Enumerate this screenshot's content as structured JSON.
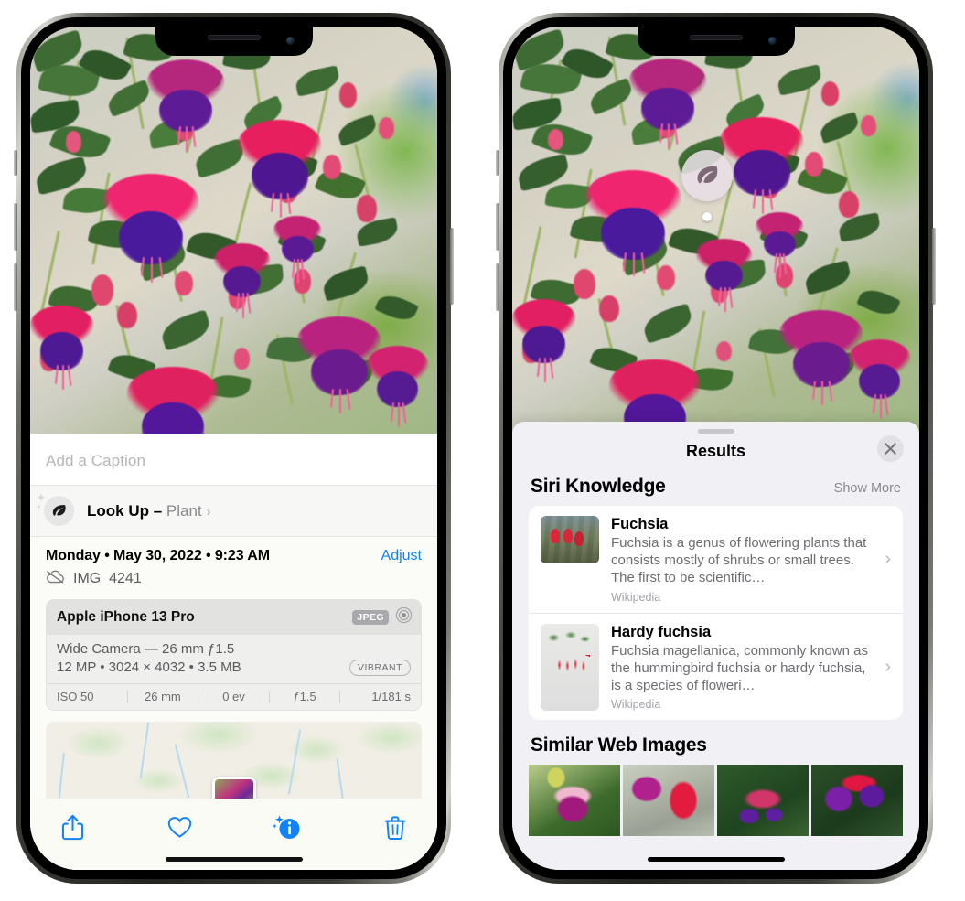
{
  "device": {
    "model_name": "iPhone",
    "buttons": [
      "silent-switch",
      "volume-up",
      "volume-down",
      "side-button"
    ]
  },
  "left_phone": {
    "screen": "photos-info-view",
    "caption": {
      "value": "",
      "placeholder": "Add a Caption"
    },
    "lookup": {
      "icon": "leaf-icon",
      "label": "Look Up",
      "dash": " – ",
      "subject": "Plant",
      "chevron": "›"
    },
    "meta": {
      "datetime": "Monday • May 30, 2022 • 9:23 AM",
      "adjust_label": "Adjust",
      "cloud_icon": "icloud-slash-icon",
      "filename": "IMG_4241"
    },
    "camera_card": {
      "model": "Apple iPhone 13 Pro",
      "format_tag": "JPEG",
      "aperture_icon": "lens-icon",
      "lens_line": "Wide Camera — 26 mm ƒ1.5",
      "size_line": "12 MP • 3024 × 4032 • 3.5 MB",
      "style_tag": "VIBRANT",
      "exif": [
        "ISO 50",
        "26 mm",
        "0 ev",
        "ƒ1.5",
        "1/181 s"
      ]
    },
    "map": {
      "label": "photo-location-map"
    },
    "toolbar": [
      {
        "name": "share-button",
        "icon": "share-icon"
      },
      {
        "name": "favorite-button",
        "icon": "heart-icon"
      },
      {
        "name": "info-button",
        "icon": "info-sparkle-icon"
      },
      {
        "name": "delete-button",
        "icon": "trash-icon"
      }
    ],
    "accent_color": "#1283f5"
  },
  "right_phone": {
    "screen": "visual-look-up-results",
    "vlu_badge": {
      "icon": "leaf-icon",
      "name": "visual-look-up-badge"
    },
    "sheet": {
      "title": "Results",
      "close_icon": "close-icon",
      "grabber": "drag-handle"
    },
    "siri_knowledge": {
      "section_title": "Siri Knowledge",
      "action_label": "Show More",
      "items": [
        {
          "title": "Fuchsia",
          "description": "Fuchsia is a genus of flowering plants that consists mostly of shrubs or small trees. The first to be scientific…",
          "source": "Wikipedia",
          "chevron": "›"
        },
        {
          "title": "Hardy fuchsia",
          "description": "Fuchsia magellanica, commonly known as the hummingbird fuchsia or hardy fuchsia, is a species of floweri…",
          "source": "Wikipedia",
          "chevron": "›"
        }
      ]
    },
    "similar_web_images": {
      "section_title": "Similar Web Images",
      "count": 4
    }
  }
}
